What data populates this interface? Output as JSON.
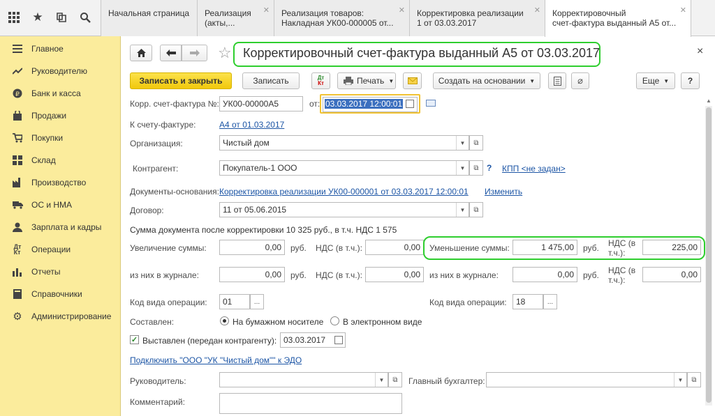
{
  "top_tabs": [
    {
      "line1": "Начальная страница",
      "line2": ""
    },
    {
      "line1": "Реализация",
      "line2": "(акты,..."
    },
    {
      "line1": "Реализация товаров:",
      "line2": "Накладная УК00-000005 от..."
    },
    {
      "line1": "Корректировка реализации",
      "line2": "1 от 03.03.2017"
    },
    {
      "line1": "Корректировочный",
      "line2": "счет-фактура выданный А5 от..."
    }
  ],
  "sidebar": {
    "items": [
      {
        "label": "Главное"
      },
      {
        "label": "Руководителю"
      },
      {
        "label": "Банк и касса"
      },
      {
        "label": "Продажи"
      },
      {
        "label": "Покупки"
      },
      {
        "label": "Склад"
      },
      {
        "label": "Производство"
      },
      {
        "label": "ОС и НМА"
      },
      {
        "label": "Зарплата и кадры"
      },
      {
        "label": "Операции"
      },
      {
        "label": "Отчеты"
      },
      {
        "label": "Справочники"
      },
      {
        "label": "Администрирование"
      }
    ]
  },
  "doc": {
    "title": "Корректировочный счет-фактура выданный А5 от 03.03.2017",
    "close": "×"
  },
  "toolbar": {
    "save_close": "Записать и закрыть",
    "save": "Записать",
    "dtkt": "Дт Кт",
    "print": "Печать",
    "create_basis": "Создать на основании",
    "more": "Еще",
    "help": "?"
  },
  "form": {
    "corr_no_label": "Корр. счет-фактура №:",
    "corr_no": "УК00-00000А5",
    "from_label": "от:",
    "from_date": "03.03.2017 12:00:01",
    "invoice_label": "К счету-фактуре:",
    "invoice_link": "А4 от 01.03.2017",
    "org_label": "Организация:",
    "org": "Чистый дом",
    "contractor_label": "Контрагент:",
    "contractor": "Покупатель-1 ООО",
    "kpp_link": "КПП <не задан>",
    "basis_label": "Документы-основания:",
    "basis_link": "Корректировка реализации УК00-000001 от 03.03.2017 12:00:01",
    "change_link": "Изменить",
    "contract_label": "Договор:",
    "contract": "11 от 05.06.2015",
    "sum_text": "Сумма документа после корректировки 10 325 руб., в т.ч. НДС 1 575",
    "increase_label": "Увеличение суммы:",
    "increase_value": "0,00",
    "rub": "руб.",
    "vat_incl_label": "НДС (в т.ч.):",
    "increase_vat": "0,00",
    "decrease_label": "Уменьшение суммы:",
    "decrease_value": "1 475,00",
    "vat_incl_label_wrapped_1": "НДС (в",
    "vat_incl_label_wrapped_2": "т.ч.):",
    "decrease_vat": "225,00",
    "journal_label": "из них в журнале:",
    "journal_inc": "0,00",
    "journal_inc_vat": "0,00",
    "journal_dec": "0,00",
    "journal_dec_vat": "0,00",
    "op_code_label": "Код вида операции:",
    "op_code_left": "01",
    "op_code_right": "18",
    "ellipsis": "...",
    "composed_label": "Составлен:",
    "paper_option": "На бумажном носителе",
    "electronic_option": "В электронном виде",
    "issued_label": "Выставлен (передан контрагенту):",
    "issued_date": "03.03.2017",
    "edo_link": "Подключить \"ООО \"УК \"Чистый дом\"\" к ЭДО",
    "head_label": "Руководитель:",
    "head_value": "",
    "accountant_label": "Главный бухгалтер:",
    "accountant_value": "",
    "comment_label": "Комментарий:",
    "comment_value": ""
  }
}
